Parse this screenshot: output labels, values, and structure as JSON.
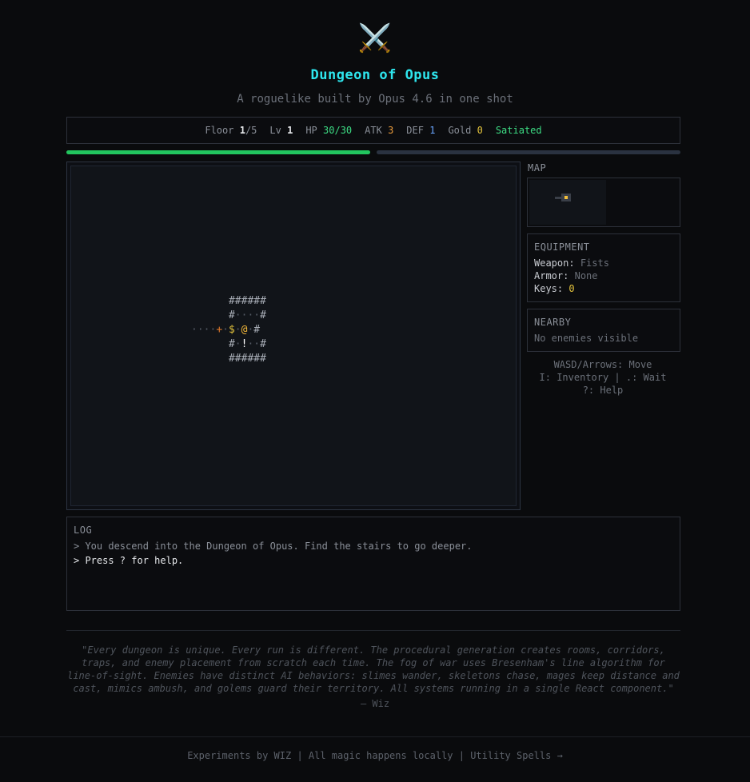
{
  "header": {
    "logo_glyph": "⚔️",
    "title": "Dungeon of Opus",
    "subtitle": "A roguelike built by Opus 4.6 in one shot"
  },
  "stats": {
    "floor_label": "Floor",
    "floor_current": "1",
    "floor_total": "/5",
    "level_label": "Lv",
    "level": "1",
    "hp_label": "HP",
    "hp": "30/30",
    "atk_label": "ATK",
    "atk": "3",
    "def_label": "DEF",
    "def": "1",
    "gold_label": "Gold",
    "gold": "0",
    "hunger": "Satiated",
    "hp_fraction": 1.0,
    "xp_fraction": 0.0
  },
  "map": {
    "tiles": [
      "      ######",
      "      #····#",
      "····+·$·@·#",
      "      #·!··#",
      "      ######"
    ]
  },
  "sidebar": {
    "map_label": "MAP",
    "equipment": {
      "heading": "EQUIPMENT",
      "weapon_label": "Weapon:",
      "weapon": "Fists",
      "armor_label": "Armor:",
      "armor": "None",
      "keys_label": "Keys:",
      "keys": "0"
    },
    "nearby": {
      "heading": "NEARBY",
      "text": "No enemies visible"
    },
    "help": {
      "line1": "WASD/Arrows: Move",
      "line2": "I: Inventory | .: Wait",
      "line3": "?: Help"
    }
  },
  "log": {
    "heading": "LOG",
    "entries": [
      "> You descend into the Dungeon of Opus. Find the stairs to go deeper.",
      "> Press ? for help."
    ]
  },
  "quote": {
    "text": "\"Every dungeon is unique. Every run is different. The procedural generation creates rooms, corridors, traps, and enemy placement from scratch each time. The fog of war uses Bresenham's line algorithm for line-of-sight. Enemies have distinct AI behaviors: slimes wander, skeletons chase, mages keep distance and cast, mimics ambush, and golems guard their territory. All systems running in a single React component.\"",
    "signature": "— Wiz"
  },
  "footer": {
    "text": "Experiments by WIZ | All magic happens locally | ",
    "link": "Utility Spells →"
  },
  "colors": {
    "title": "#2ee6ee",
    "hp_bar": "#22c55e",
    "gold": "#e2c23c",
    "player": "#f5b93a",
    "door": "#e07a2a"
  }
}
